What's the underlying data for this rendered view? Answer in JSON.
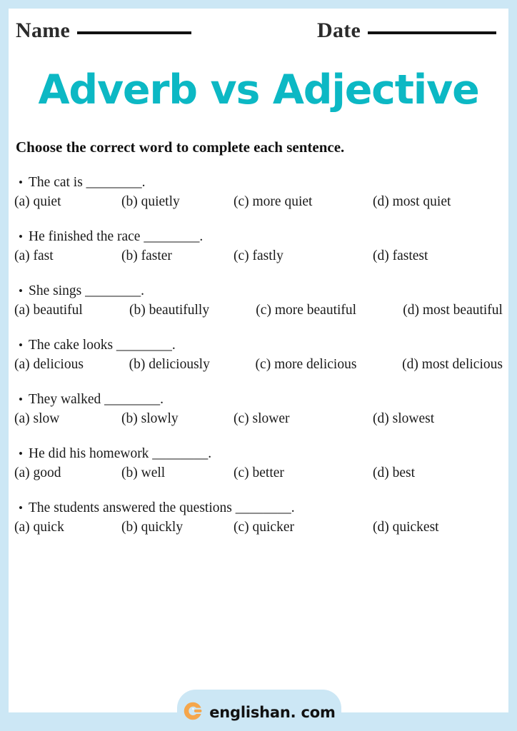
{
  "theme": {
    "frame_color": "#cce7f5",
    "title_color": "#0cb8c4",
    "logo_color": "#f5a council",
    "text_color": "#1a1a1a"
  },
  "header": {
    "name_label": "Name",
    "date_label": "Date"
  },
  "title": "Adverb vs Adjective",
  "instruction": "Choose the correct word to complete each sentence.",
  "questions": [
    {
      "bullet": "•",
      "text": "The cat is ________.",
      "options": [
        "(a) quiet",
        "(b) quietly",
        "(c) more quiet",
        "(d) most quiet"
      ],
      "wide": false
    },
    {
      "bullet": "•",
      "text": "He finished the race ________.",
      "options": [
        "(a) fast",
        "(b) faster",
        "(c) fastly",
        "(d) fastest"
      ],
      "wide": false
    },
    {
      "bullet": "•",
      "text": "She sings ________.",
      "options": [
        "(a) beautiful",
        "(b) beautifully",
        "(c) more beautiful",
        "(d) most beautiful"
      ],
      "wide": true
    },
    {
      "bullet": "•",
      "text": "The cake looks ________.",
      "options": [
        "(a) delicious",
        "(b) deliciously",
        "(c) more delicious",
        "(d) most delicious"
      ],
      "wide": true
    },
    {
      "bullet": "•",
      "text": "They walked ________.",
      "options": [
        "(a) slow",
        "(b) slowly",
        "(c) slower",
        "(d) slowest"
      ],
      "wide": false
    },
    {
      "bullet": "•",
      "text": "He did his homework ________.",
      "options": [
        "(a) good",
        "(b) well",
        "(c) better",
        "(d) best"
      ],
      "wide": false
    },
    {
      "bullet": "•",
      "text": "The students answered the questions ________.",
      "options": [
        "(a) quick",
        "(b) quickly",
        "(c) quicker",
        "(d) quickest"
      ],
      "wide": false
    }
  ],
  "footer": {
    "brand": "englishan. com",
    "logo_icon": "englishan-c-logo-icon"
  }
}
